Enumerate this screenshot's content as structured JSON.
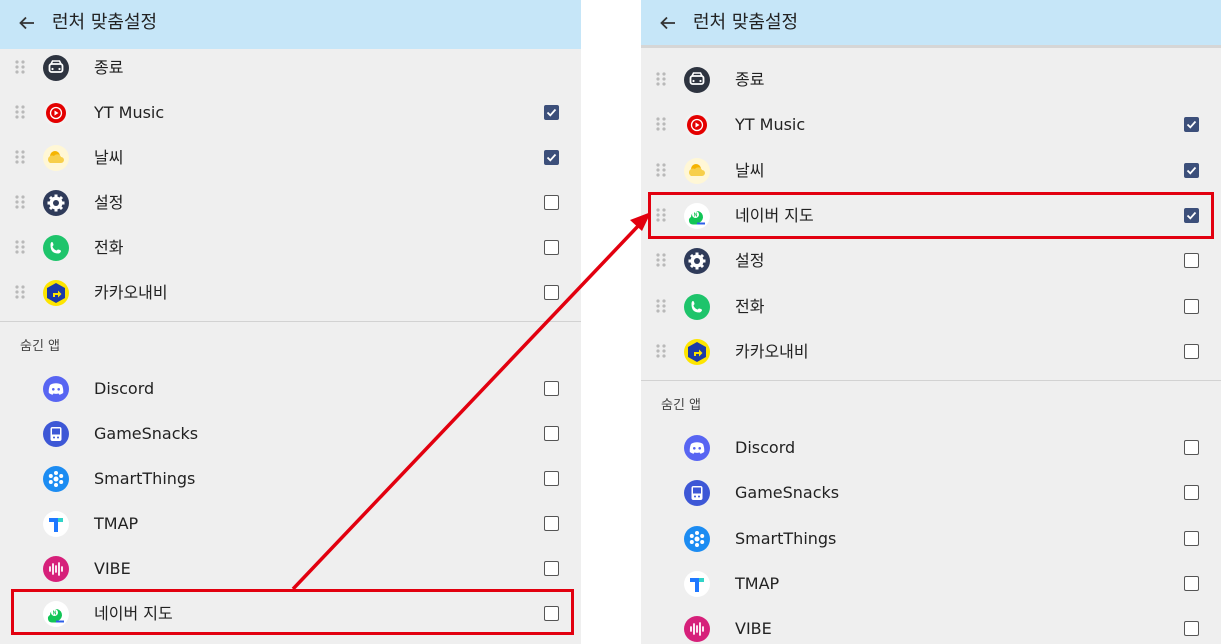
{
  "panels": {
    "left": {
      "title": "런처 맞춤설정",
      "visible": [
        {
          "label": "종료",
          "icon": "car-icon",
          "checked": null
        },
        {
          "label": "YT Music",
          "icon": "yt-music-icon",
          "checked": true
        },
        {
          "label": "날씨",
          "icon": "weather-icon",
          "checked": true
        },
        {
          "label": "설정",
          "icon": "settings-icon",
          "checked": false
        },
        {
          "label": "전화",
          "icon": "phone-icon",
          "checked": false
        },
        {
          "label": "카카오내비",
          "icon": "kakao-navi-icon",
          "checked": false
        }
      ],
      "hidden_label": "숨긴 앱",
      "hidden": [
        {
          "label": "Discord",
          "icon": "discord-icon",
          "checked": false
        },
        {
          "label": "GameSnacks",
          "icon": "gamesnacks-icon",
          "checked": false
        },
        {
          "label": "SmartThings",
          "icon": "smartthings-icon",
          "checked": false
        },
        {
          "label": "TMAP",
          "icon": "tmap-icon",
          "checked": false
        },
        {
          "label": "VIBE",
          "icon": "vibe-icon",
          "checked": false
        },
        {
          "label": "네이버 지도",
          "icon": "naver-map-icon",
          "checked": false
        }
      ]
    },
    "right": {
      "title": "런처 맞춤설정",
      "visible": [
        {
          "label": "종료",
          "icon": "car-icon",
          "checked": null
        },
        {
          "label": "YT Music",
          "icon": "yt-music-icon",
          "checked": true
        },
        {
          "label": "날씨",
          "icon": "weather-icon",
          "checked": true
        },
        {
          "label": "네이버 지도",
          "icon": "naver-map-icon",
          "checked": true
        },
        {
          "label": "설정",
          "icon": "settings-icon",
          "checked": false
        },
        {
          "label": "전화",
          "icon": "phone-icon",
          "checked": false
        },
        {
          "label": "카카오내비",
          "icon": "kakao-navi-icon",
          "checked": false
        }
      ],
      "hidden_label": "숨긴 앱",
      "hidden": [
        {
          "label": "Discord",
          "icon": "discord-icon",
          "checked": false
        },
        {
          "label": "GameSnacks",
          "icon": "gamesnacks-icon",
          "checked": false
        },
        {
          "label": "SmartThings",
          "icon": "smartthings-icon",
          "checked": false
        },
        {
          "label": "TMAP",
          "icon": "tmap-icon",
          "checked": false
        },
        {
          "label": "VIBE",
          "icon": "vibe-icon",
          "checked": false
        }
      ]
    }
  },
  "colors": {
    "appbar": "#c6e6f8",
    "list_bg": "#efefef",
    "checkbox_checked": "#3c4f7a",
    "highlight": "#e2000f"
  }
}
